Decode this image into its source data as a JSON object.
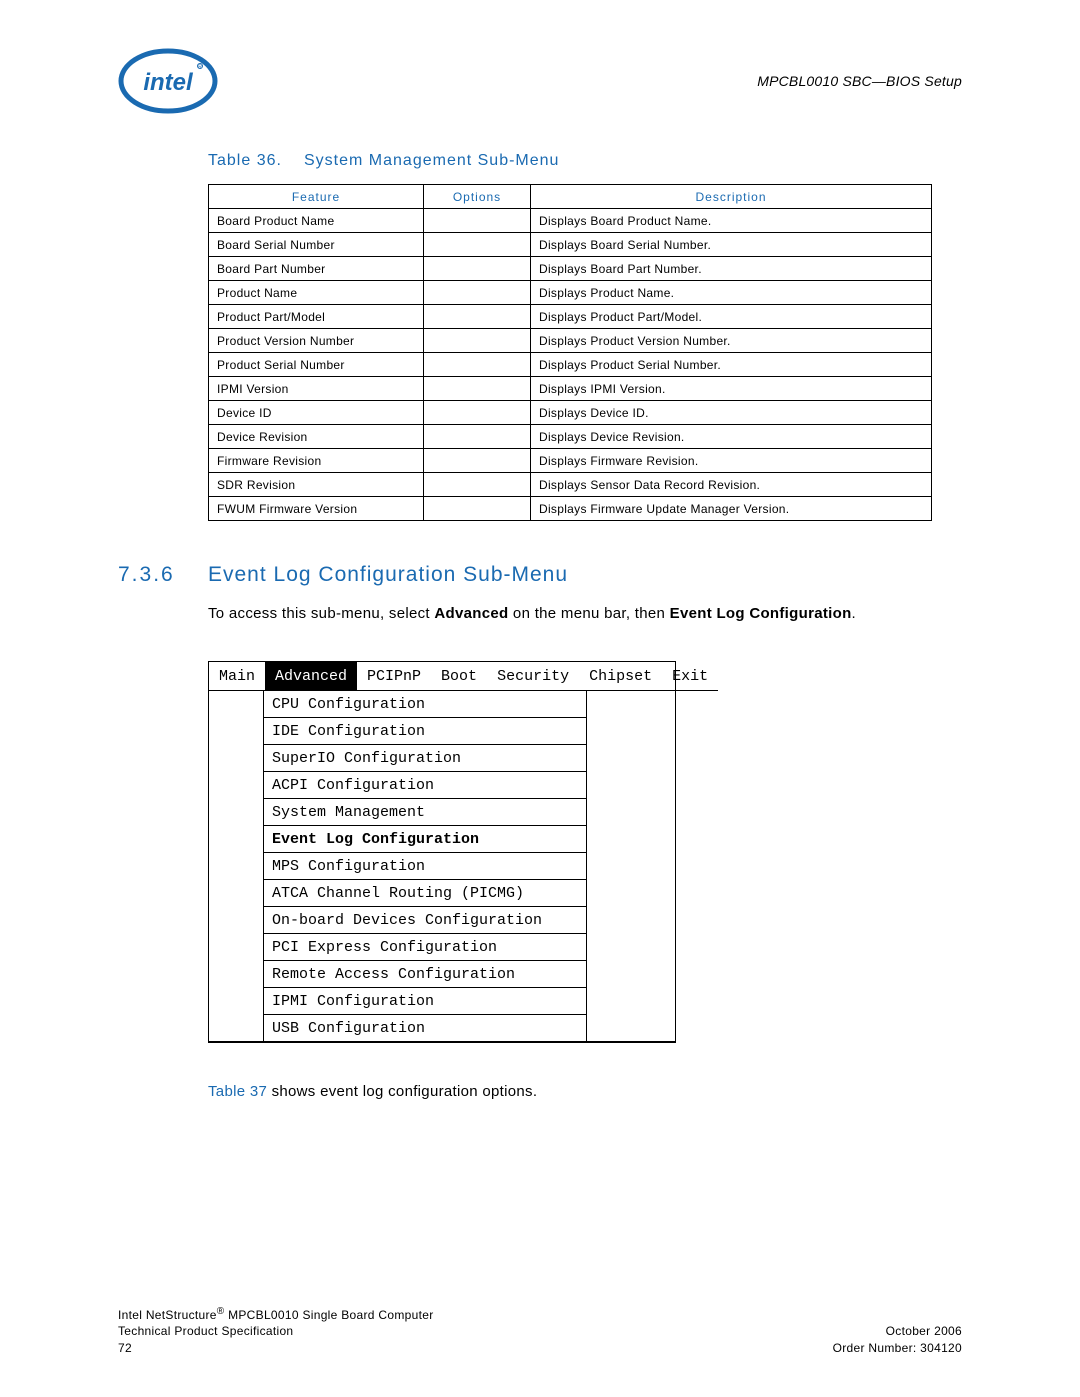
{
  "header": {
    "doc_title": "MPCBL0010 SBC—BIOS Setup"
  },
  "table36": {
    "caption_num": "Table 36.",
    "caption_title": "System Management Sub-Menu",
    "headers": {
      "feature": "Feature",
      "options": "Options",
      "description": "Description"
    },
    "rows": [
      {
        "feature": "Board Product Name",
        "options": "",
        "description": "Displays Board Product Name."
      },
      {
        "feature": "Board Serial Number",
        "options": "",
        "description": "Displays Board Serial Number."
      },
      {
        "feature": "Board Part Number",
        "options": "",
        "description": "Displays Board Part Number."
      },
      {
        "feature": "Product Name",
        "options": "",
        "description": "Displays Product Name."
      },
      {
        "feature": "Product Part/Model",
        "options": "",
        "description": "Displays Product Part/Model."
      },
      {
        "feature": "Product Version Number",
        "options": "",
        "description": "Displays Product Version Number."
      },
      {
        "feature": "Product Serial Number",
        "options": "",
        "description": "Displays Product Serial Number."
      },
      {
        "feature": "IPMI Version",
        "options": "",
        "description": "Displays IPMI Version."
      },
      {
        "feature": "Device ID",
        "options": "",
        "description": "Displays Device ID."
      },
      {
        "feature": "Device Revision",
        "options": "",
        "description": "Displays Device Revision."
      },
      {
        "feature": "Firmware Revision",
        "options": "",
        "description": "Displays Firmware Revision."
      },
      {
        "feature": "SDR Revision",
        "options": "",
        "description": "Displays Sensor Data Record Revision."
      },
      {
        "feature": "FWUM Firmware Version",
        "options": "",
        "description": "Displays Firmware Update Manager Version."
      }
    ]
  },
  "section": {
    "num": "7.3.6",
    "title": "Event Log Configuration Sub-Menu",
    "body_prefix": "To access this sub-menu, select ",
    "body_bold1": "Advanced",
    "body_mid": " on the menu bar, then ",
    "body_bold2": "Event Log Configuration",
    "body_suffix": "."
  },
  "bios": {
    "tabs": [
      "Main",
      "Advanced",
      "PCIPnP",
      "Boot",
      "Security",
      "Chipset",
      "Exit"
    ],
    "selected_tab_index": 1,
    "items": [
      "CPU Configuration",
      "IDE Configuration",
      "SuperIO Configuration",
      "ACPI Configuration",
      "System Management",
      "Event Log Configuration",
      "MPS Configuration",
      "ATCA Channel Routing (PICMG)",
      "On-board Devices Configuration",
      "PCI Express Configuration",
      "Remote Access Configuration",
      "IPMI Configuration",
      "USB Configuration"
    ],
    "selected_item_index": 5
  },
  "ref": {
    "link": "Table 37",
    "text": " shows event log configuration options."
  },
  "footer": {
    "left_line1a": "Intel NetStructure",
    "left_line1b": " MPCBL0010 Single Board Computer",
    "left_line2": "Technical Product Specification",
    "left_line3": "72",
    "right_line1": "October 2006",
    "right_line2": "Order Number: 304120"
  }
}
